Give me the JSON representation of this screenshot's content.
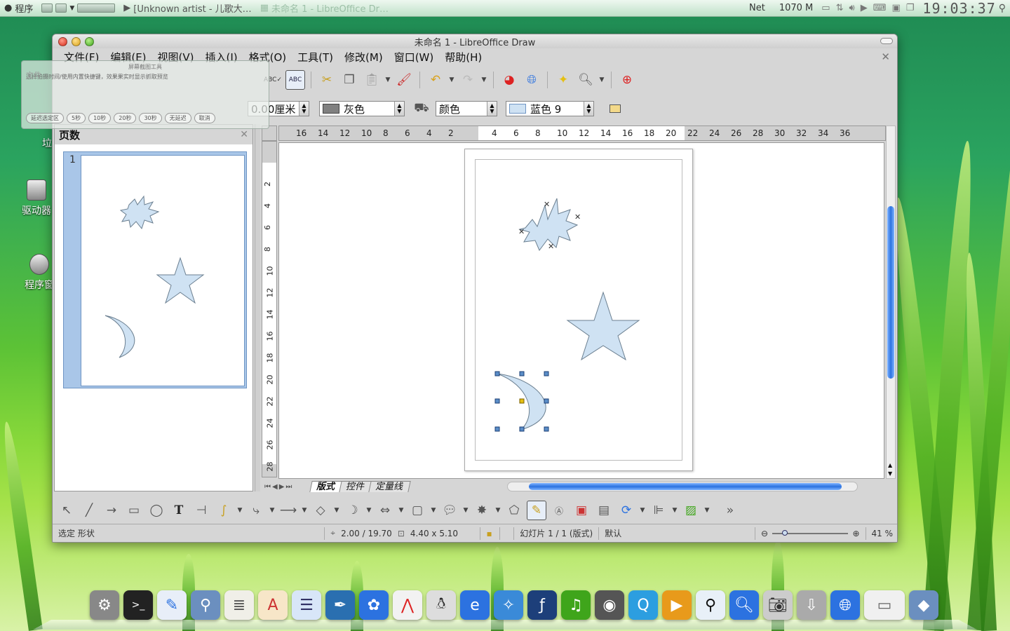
{
  "top_panel": {
    "menu_label": "程序",
    "tasks": [
      "[Unknown artist - 儿歌大…",
      "未命名 1 - LibreOffice Dr…"
    ],
    "net_label": "Net",
    "memory": "1070 M",
    "clock": "19:03:37"
  },
  "desktop_icons": [
    "垃圾",
    "驱动器",
    "程序窗"
  ],
  "window": {
    "title": "未命名 1 - LibreOffice Draw",
    "menus": [
      "文件(F)",
      "编辑(E)",
      "视图(V)",
      "插入(I)",
      "格式(O)",
      "工具(T)",
      "修改(M)",
      "窗口(W)",
      "帮助(H)"
    ]
  },
  "ghost_panel": {
    "title": "屏幕截图工具",
    "file_label": "文件",
    "hint": "选择拍摄时间/使用内置快捷键，效果果实时显示抓取预览",
    "timers": [
      "延迟选定区",
      "5秒",
      "10秒",
      "20秒",
      "30秒",
      "无延迟",
      "取消"
    ]
  },
  "format_toolbar": {
    "line_width": "0.00厘米",
    "line_color": "灰色",
    "area_style": "颜色",
    "area_color": "蓝色 9"
  },
  "colors": {
    "line_gray": "#808080",
    "area_blue9": "#cfe2f3",
    "accent_blue": "#2c72e0"
  },
  "slide_pane": {
    "title": "页数",
    "slide_number": "1"
  },
  "ruler_h_labels": [
    "16",
    "14",
    "12",
    "10",
    "8",
    "6",
    "4",
    "2",
    "",
    "4",
    "6",
    "8",
    "10",
    "12",
    "14",
    "16",
    "18",
    "20",
    "22",
    "24",
    "26",
    "28",
    "30",
    "32",
    "34",
    "36"
  ],
  "ruler_v_labels": [
    "2",
    "4",
    "6",
    "8",
    "10",
    "12",
    "14",
    "16",
    "18",
    "20",
    "22",
    "24",
    "26",
    "28"
  ],
  "layer_tabs": [
    "版式",
    "控件",
    "定量线"
  ],
  "status_bar": {
    "action": "选定 形状",
    "position": "2.00 / 19.70",
    "size": "4.40 x 5.10",
    "slide_info": "幻灯片 1 / 1 (版式)",
    "master": "默认",
    "zoom": "41 %"
  }
}
